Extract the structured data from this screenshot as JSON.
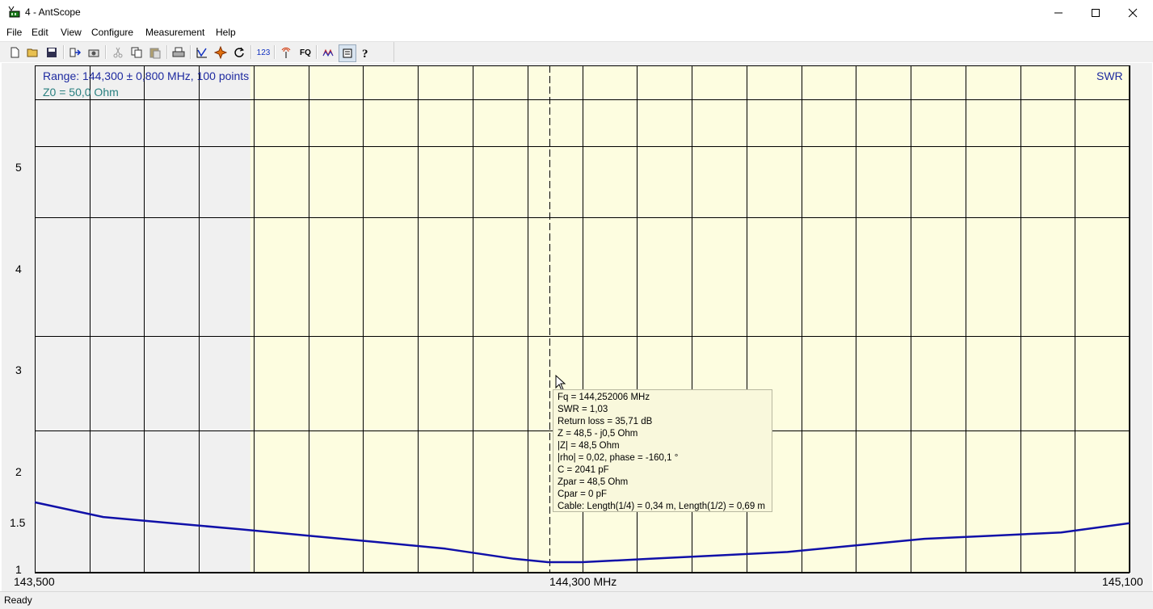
{
  "window": {
    "title": "4 - AntScope",
    "minimize_icon": "minimize-icon",
    "maximize_icon": "maximize-icon",
    "close_icon": "close-icon"
  },
  "menu": [
    "File",
    "Edit",
    "View",
    "Configure",
    "Measurement",
    "Help"
  ],
  "toolbar_icons": [
    "new-icon",
    "open-icon",
    "save-icon",
    "export-icon",
    "snapshot-icon",
    "cut-icon",
    "copy-icon",
    "paste-icon",
    "print-icon",
    "graph-icon",
    "marker-icon",
    "refresh-icon",
    "numbers-icon",
    "antenna-icon",
    "fq-icon",
    "smith-icon",
    "notes-icon",
    "help-icon"
  ],
  "toolbar": {
    "numbers_label": "123",
    "fq_label": "FQ"
  },
  "plot": {
    "range_text": "Range: 144,300 ± 0,800 MHz, 100 points",
    "z0_text": "Z0 = 50,0 Ohm",
    "mode_label": "SWR",
    "x_labels": {
      "left": "143,500",
      "center": "144,300 MHz",
      "right": "145,100"
    },
    "y_labels": [
      "5",
      "4",
      "3",
      "2",
      "1.5",
      "1"
    ],
    "colors": {
      "trace": "#1010a8",
      "band": "#fdfde0",
      "background": "#f0f0f0",
      "grid": "#000000"
    }
  },
  "chart_data": {
    "type": "line",
    "title": "",
    "xlabel": "MHz",
    "ylabel": "SWR",
    "xlim": [
      143.5,
      145.1
    ],
    "ylim": [
      1,
      6
    ],
    "y_scale": "swr-reflection",
    "highlight_band": [
      143.815,
      145.1
    ],
    "cursor_x": 144.252006,
    "series": [
      {
        "name": "SWR",
        "x": [
          143.5,
          143.6,
          143.7,
          143.8,
          143.9,
          144.0,
          144.1,
          144.2,
          144.25,
          144.3,
          144.4,
          144.5,
          144.6,
          144.7,
          144.8,
          144.9,
          145.0,
          145.1
        ],
        "values": [
          1.22,
          1.17,
          1.15,
          1.13,
          1.11,
          1.09,
          1.07,
          1.04,
          1.03,
          1.03,
          1.04,
          1.05,
          1.06,
          1.08,
          1.1,
          1.11,
          1.12,
          1.15
        ]
      }
    ]
  },
  "tooltip": {
    "lines": [
      "Fq = 144,252006 MHz",
      "SWR = 1,03",
      "Return loss = 35,71 dB",
      "Z = 48,5 - j0,5 Ohm",
      "|Z| = 48,5 Ohm",
      "|rho| = 0,02, phase = -160,1 °",
      "C = 2041 pF",
      "Zpar = 48,5 Ohm",
      "Cpar = 0 pF",
      "Cable: Length(1/4) = 0,34 m, Length(1/2) = 0,69 m"
    ]
  },
  "status": {
    "text": "Ready"
  }
}
